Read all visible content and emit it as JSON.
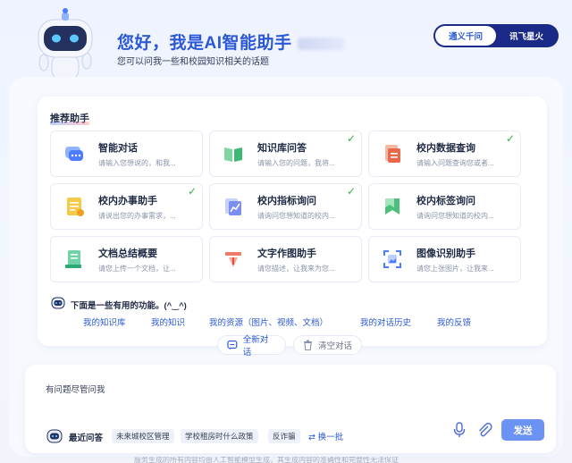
{
  "header": {
    "title": "您好，我是AI智能助手",
    "subtitle": "您可以问我一些和校园知识相关的话题"
  },
  "model_switch": {
    "options": [
      {
        "label": "通义千问",
        "active": true
      },
      {
        "label": "讯飞星火",
        "active": false
      }
    ]
  },
  "assistants": {
    "section_title": "推荐助手",
    "cards": [
      {
        "name": "智能对话",
        "desc": "请输入您想说的，和我...",
        "checked": false,
        "icon": "chat-icon"
      },
      {
        "name": "知识库问答",
        "desc": "请输入您的问题，我将...",
        "checked": true,
        "icon": "book-icon"
      },
      {
        "name": "校内数据查询",
        "desc": "请输入问题查询您或者...",
        "checked": true,
        "icon": "data-doc-icon"
      },
      {
        "name": "校内办事助手",
        "desc": "请说出您的办事需求，...",
        "checked": true,
        "icon": "task-doc-icon"
      },
      {
        "name": "校内指标询问",
        "desc": "请询问您想知道的校内...",
        "checked": true,
        "icon": "metrics-icon"
      },
      {
        "name": "校内标签询问",
        "desc": "请询问您想知道的校内...",
        "checked": false,
        "icon": "tag-icon"
      },
      {
        "name": "文档总结概要",
        "desc": "请您上传一个文档，让...",
        "checked": false,
        "icon": "summary-doc-icon"
      },
      {
        "name": "文字作图助手",
        "desc": "请您描述，让我来为您...",
        "checked": false,
        "icon": "draw-icon"
      },
      {
        "name": "图像识别助手",
        "desc": "请您上张图片，让我来...",
        "checked": false,
        "icon": "image-scan-icon"
      }
    ]
  },
  "useful": {
    "title": "下面是一些有用的功能。(^‿^)",
    "links": [
      "我的知识库",
      "我的知识",
      "我的资源（图片、视频、文档）",
      "我的对话历史",
      "我的反馈"
    ]
  },
  "actions": {
    "new_chat": "全新对话",
    "clear_chat": "清空对话"
  },
  "input": {
    "placeholder": "有问题尽管问我",
    "send": "发送"
  },
  "recent": {
    "label": "最近问答",
    "tags": [
      "未来城校区管理",
      "学校租房时什么政策",
      "反诈骗"
    ],
    "refresh": "换一批"
  },
  "colors": {
    "accent": "#2b58d6",
    "switch_bg": "#1a2a86",
    "check": "#3fae4b",
    "send_bg": "#6b93f4"
  },
  "footer": {
    "note": "服务生成的所有内容均由人工智能模型生成，其生成内容的准确性和完整性无法保证"
  }
}
